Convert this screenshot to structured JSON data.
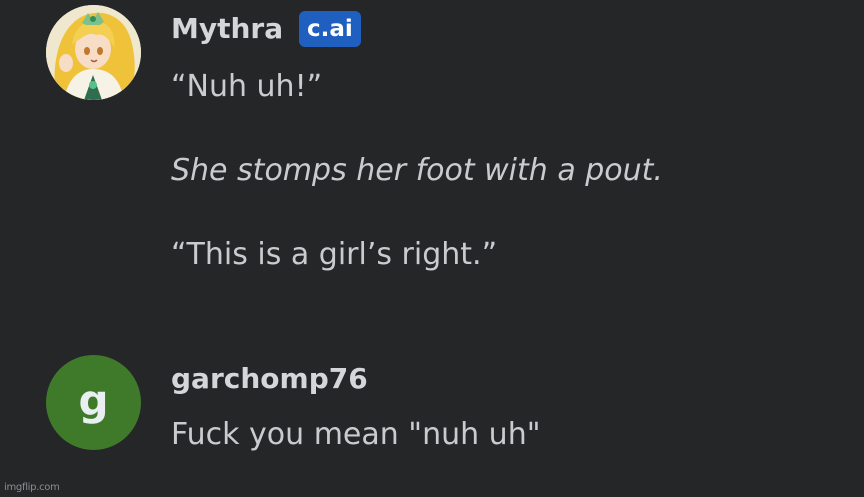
{
  "messages": [
    {
      "author": "Mythra",
      "badge": "c.ai",
      "lines": [
        "“Nuh uh!”",
        "She stomps her foot with a pout.",
        "“This is a girl’s right.”"
      ],
      "avatar_icon": "anime-character-avatar"
    },
    {
      "author": "garchomp76",
      "avatar_letter": "g",
      "avatar_color": "#3f7a2a",
      "lines": [
        "Fuck you mean \"nuh uh\""
      ]
    }
  ],
  "watermark": "imgflip.com",
  "colors": {
    "background": "#242628",
    "text": "#c9ccce",
    "badge": "#1f5fbf"
  }
}
